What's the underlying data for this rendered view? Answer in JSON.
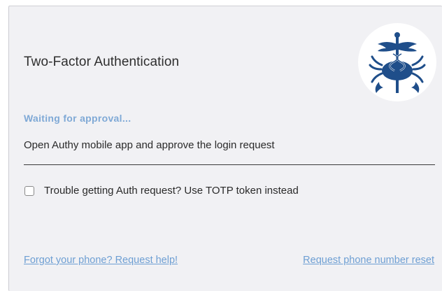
{
  "dialog": {
    "title": "Two-Factor Authentication",
    "logo_icon": "caduceus-crab-logo",
    "status_text": "Waiting for approval...",
    "instruction_text": "Open Authy mobile app and approve the login request",
    "totp_option": {
      "label": "Trouble getting Auth request? Use TOTP token instead",
      "checked": false
    },
    "links": {
      "forgot_phone": "Forgot your phone? Request help!",
      "reset_phone": "Request phone number reset"
    }
  },
  "colors": {
    "card_background": "#f1f1f4",
    "status_accent": "#7fa9d6",
    "link": "#6e9fd3",
    "logo_primary": "#1f4e8a"
  }
}
